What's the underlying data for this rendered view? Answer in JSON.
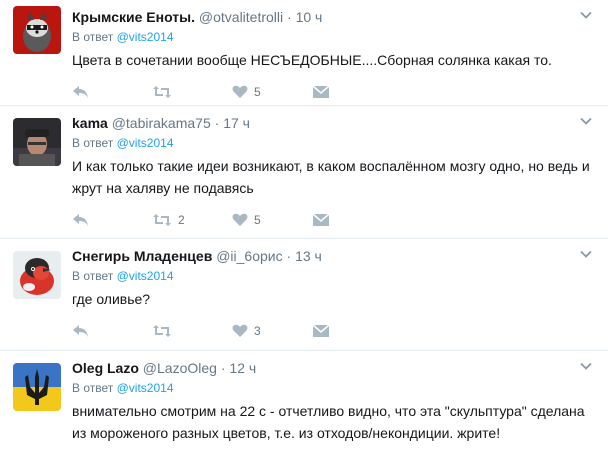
{
  "tweets": [
    {
      "fullname": "Крымские Еноты.",
      "username": "@otvalitetrolli",
      "time": "10 ч",
      "reply_prefix": "В ответ",
      "reply_to": "@vits2014",
      "text": "Цвета в сочетании вообще НЕСЪЕДОБНЫЕ....Сборная солянка какая то.",
      "retweets": "",
      "likes": "5",
      "avatar_icon": "raccoon-avatar"
    },
    {
      "fullname": "kama",
      "username": "@tabirakama75",
      "time": "17 ч",
      "reply_prefix": "В ответ",
      "reply_to": "@vits2014",
      "text": "И как только такие идеи возникают, в каком воспалённом мозгу одно, но ведь и жрут на халяву не подавясь",
      "retweets": "2",
      "likes": "5",
      "avatar_icon": "man-in-cap-avatar"
    },
    {
      "fullname": "Снегирь Младенцев",
      "username": "@ii_6орис",
      "time": "13 ч",
      "reply_prefix": "В ответ",
      "reply_to": "@vits2014",
      "text": "где оливье?",
      "retweets": "",
      "likes": "3",
      "avatar_icon": "bullfinch-avatar"
    },
    {
      "fullname": "Oleg Lazo",
      "username": "@LazoOleg",
      "time": "12 ч",
      "reply_prefix": "В ответ",
      "reply_to": "@vits2014",
      "text": "внимательно смотрим на 22 с - отчетливо видно, что эта \"скульптура\" сделана из мороженого разных цветов, т.е. из отходов/некондиции. жрите!",
      "retweets": "",
      "likes": "",
      "avatar_icon": "trident-flag-avatar"
    }
  ],
  "colors": {
    "link": "#1da1f2",
    "muted": "#657786",
    "icon": "#aab8c2",
    "border": "#e6ecf0"
  }
}
